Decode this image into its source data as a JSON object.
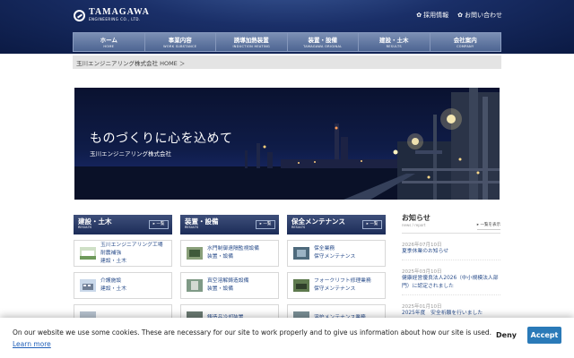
{
  "brand": {
    "name": "TAMAGAWA",
    "sub": "ENGINEERING CO., LTD."
  },
  "top_links": [
    {
      "label": "採用情報"
    },
    {
      "label": "お問い合わせ"
    }
  ],
  "nav": [
    {
      "label": "ホーム",
      "sub": "HOME"
    },
    {
      "label": "事業内容",
      "sub": "WORK SUBSTANCE"
    },
    {
      "label": "誘導加熱装置",
      "sub": "INDUCTION HEATING"
    },
    {
      "label": "装置・設備",
      "sub": "TAMAGAWA ORIGINAL"
    },
    {
      "label": "建設・土木",
      "sub": "RESULTS"
    },
    {
      "label": "会社案内",
      "sub": "COMPANY"
    }
  ],
  "breadcrumb": "玉川エンジニアリング株式会社 HOME ＞",
  "hero": {
    "title": "ものづくりに心を込めて",
    "subtitle": "玉川エンジニアリング株式会社"
  },
  "panels": [
    {
      "title": "建設・土木",
      "sub": "RESULTS",
      "more": "▸ 一覧",
      "items": [
        {
          "line1": "玉川エンジニアリング工場",
          "line2": "耐震補強",
          "cat": "建設・土木"
        },
        {
          "line1": "介護施設",
          "line2": "",
          "cat": "建設・土木"
        },
        {
          "line1": "",
          "line2": "",
          "cat": ""
        }
      ]
    },
    {
      "title": "装置・設備",
      "sub": "RESULTS",
      "more": "▸ 一覧",
      "items": [
        {
          "line1": "水門制御遠隔監視設備",
          "line2": "",
          "cat": "装置・設備"
        },
        {
          "line1": "真空溶解鋳造設備",
          "line2": "",
          "cat": "装置・設備"
        },
        {
          "line1": "鋳造品冷却装置",
          "line2": "",
          "cat": ""
        }
      ]
    },
    {
      "title": "保全メンテナンス",
      "sub": "RESULTS",
      "more": "▸ 一覧",
      "items": [
        {
          "line1": "保全業務",
          "line2": "",
          "cat": "保守メンテナンス"
        },
        {
          "line1": "フォークリフト修理業務",
          "line2": "",
          "cat": "保守メンテナンス"
        },
        {
          "line1": "溶炉メンテナンス業務",
          "line2": "",
          "cat": ""
        }
      ]
    }
  ],
  "news": {
    "title": "お知らせ",
    "sub": "news / report",
    "more": "▸ 一覧を表示",
    "items": [
      {
        "date": "2026年07月10日",
        "text": "夏季休業のお知らせ"
      },
      {
        "date": "2025年03月10日",
        "text": "健康経営優良法人2026（中小規模法人部門）に認定されました"
      },
      {
        "date": "2025年01月10日",
        "text": "2025年度　安全祈願を行いました"
      }
    ]
  },
  "cookie": {
    "message": "On our website we use some cookies. These are necessary for our site to work properly and to give us information about how our site is used.",
    "learn_more": "Learn more",
    "deny": "Deny",
    "accept": "Accept"
  }
}
